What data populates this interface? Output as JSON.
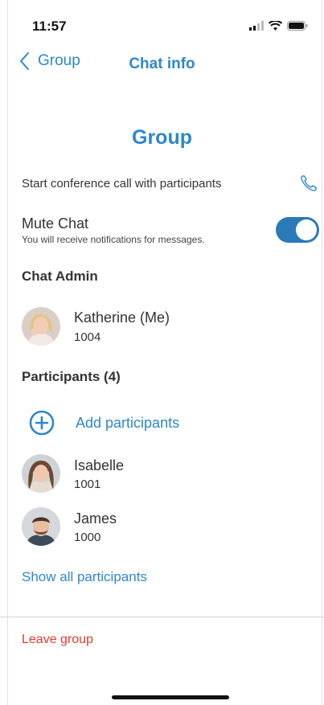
{
  "status_bar": {
    "time": "11:57"
  },
  "nav": {
    "back_label": "Group",
    "title": "Chat info"
  },
  "group": {
    "name": "Group"
  },
  "conference": {
    "label": "Start conference call with participants"
  },
  "mute": {
    "label": "Mute Chat",
    "sublabel": "You will receive notifications for messages.",
    "enabled": true
  },
  "admin_section": {
    "title": "Chat Admin",
    "person": {
      "name": "Katherine (Me)",
      "ext": "1004"
    }
  },
  "participants_section": {
    "title": "Participants (4)",
    "add_label": "Add participants",
    "people": [
      {
        "name": "Isabelle",
        "ext": "1001"
      },
      {
        "name": "James",
        "ext": "1000"
      }
    ],
    "show_all": "Show all participants"
  },
  "footer": {
    "leave_label": "Leave group"
  },
  "colors": {
    "accent": "#2f87c9",
    "toggle": "#2b7ab8",
    "danger": "#e23b2e"
  }
}
